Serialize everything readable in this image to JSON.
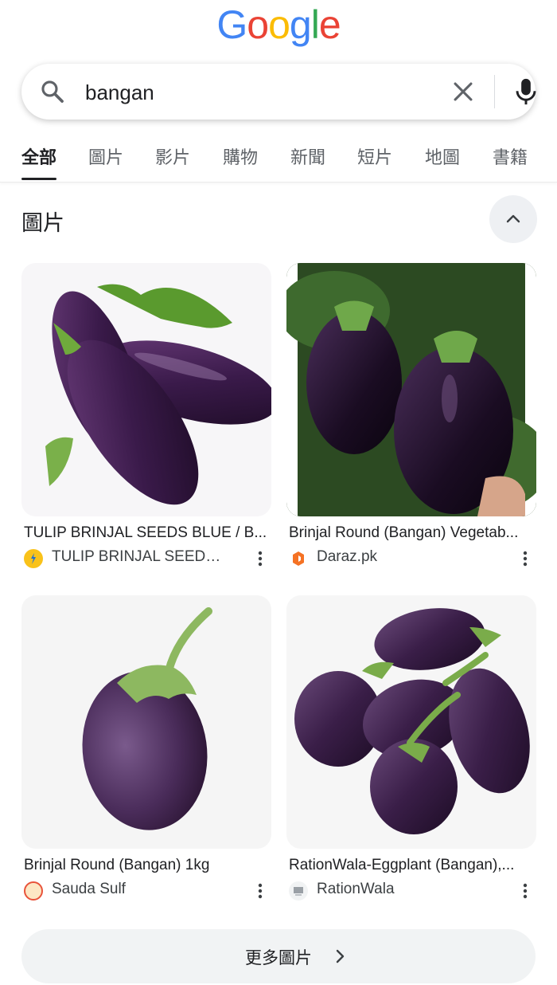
{
  "logo": {
    "letters": [
      "G",
      "o",
      "o",
      "g",
      "l",
      "e"
    ],
    "colors": [
      "#4285F4",
      "#EA4335",
      "#FBBC05",
      "#4285F4",
      "#34A853",
      "#EA4335"
    ]
  },
  "search": {
    "query": "bangan"
  },
  "tabs": [
    "全部",
    "圖片",
    "影片",
    "購物",
    "新聞",
    "短片",
    "地圖",
    "書籍"
  ],
  "images_section": {
    "title": "圖片",
    "more_label": "更多圖片"
  },
  "results": [
    {
      "title": "TULIP BRINJAL SEEDS BLUE / B...",
      "source": "TULIP BRINJAL SEEDS...",
      "favicon_color": "#F9C21A"
    },
    {
      "title": "Brinjal Round (Bangan) Vegetab...",
      "source": "Daraz.pk",
      "favicon_color": "#F57224"
    },
    {
      "title": "Brinjal Round (Bangan) 1kg",
      "source": "Sauda Sulf",
      "favicon_color": "#E8533A"
    },
    {
      "title": "RationWala-Eggplant (Bangan),...",
      "source": "RationWala",
      "favicon_color": "#9aa0a6"
    }
  ]
}
